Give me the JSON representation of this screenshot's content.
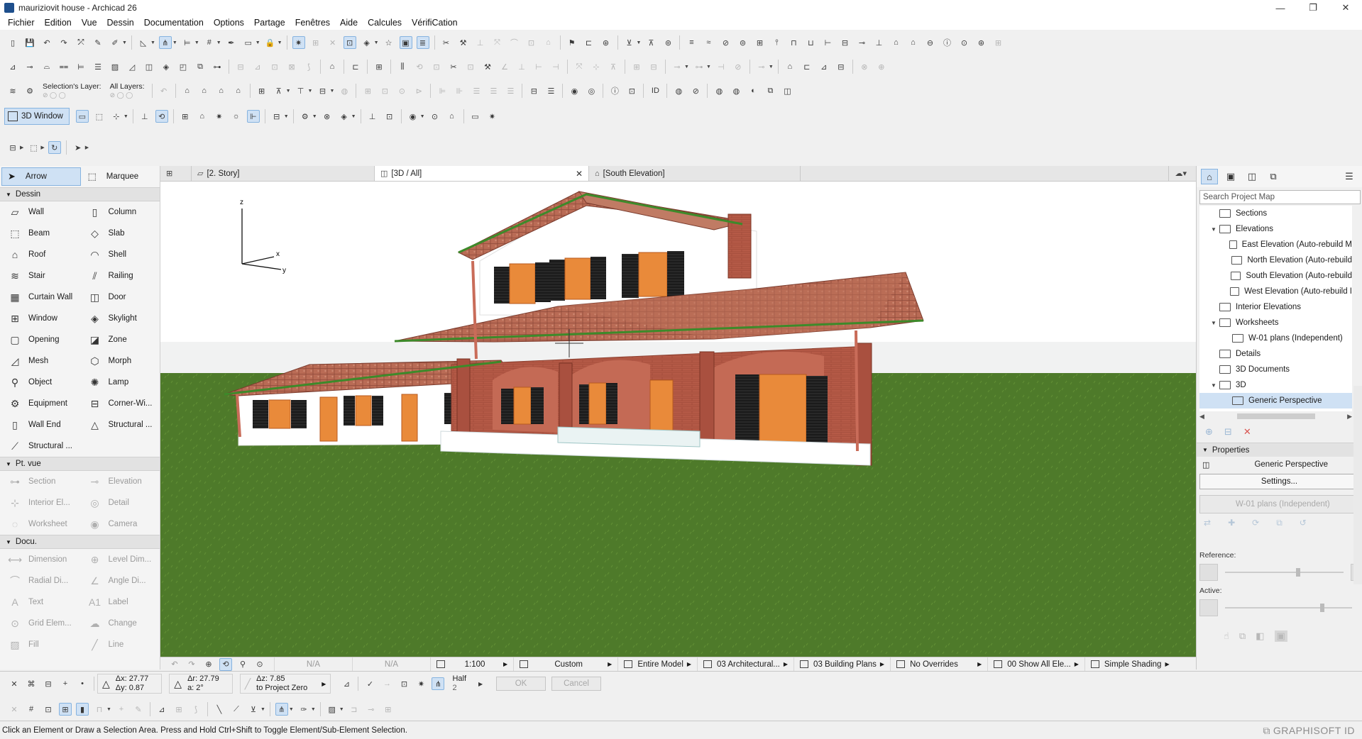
{
  "window": {
    "title": "mauriziovit house - Archicad 26",
    "minimize": "—",
    "maximize": "❐",
    "close": "✕"
  },
  "menu": [
    "Fichier",
    "Edition",
    "Vue",
    "Dessin",
    "Documentation",
    "Options",
    "Partage",
    "Fenêtres",
    "Aide",
    "Calcules",
    "VérifiCation"
  ],
  "toolbar": {
    "selection_layer_label": "Selection's Layer:",
    "all_layers_label": "All Layers:",
    "threed_window_label": "3D Window"
  },
  "toolbox": {
    "arrow_label": "Arrow",
    "marquee_label": "Marquee",
    "sections": [
      {
        "title": "Dessin",
        "tools": [
          {
            "label": "Wall",
            "icon": "wall-icon",
            "glyph": "▱"
          },
          {
            "label": "Column",
            "icon": "column-icon",
            "glyph": "▯"
          },
          {
            "label": "Beam",
            "icon": "beam-icon",
            "glyph": "⬚"
          },
          {
            "label": "Slab",
            "icon": "slab-icon",
            "glyph": "◇"
          },
          {
            "label": "Roof",
            "icon": "roof-icon",
            "glyph": "⌂"
          },
          {
            "label": "Shell",
            "icon": "shell-icon",
            "glyph": "◠"
          },
          {
            "label": "Stair",
            "icon": "stair-icon",
            "glyph": "≋"
          },
          {
            "label": "Railing",
            "icon": "railing-icon",
            "glyph": "⫽"
          },
          {
            "label": "Curtain Wall",
            "icon": "curtain-wall-icon",
            "glyph": "▦"
          },
          {
            "label": "Door",
            "icon": "door-icon",
            "glyph": "◫"
          },
          {
            "label": "Window",
            "icon": "window-icon",
            "glyph": "⊞"
          },
          {
            "label": "Skylight",
            "icon": "skylight-icon",
            "glyph": "◈"
          },
          {
            "label": "Opening",
            "icon": "opening-icon",
            "glyph": "▢"
          },
          {
            "label": "Zone",
            "icon": "zone-icon",
            "glyph": "◪"
          },
          {
            "label": "Mesh",
            "icon": "mesh-icon",
            "glyph": "◿"
          },
          {
            "label": "Morph",
            "icon": "morph-icon",
            "glyph": "⬡"
          },
          {
            "label": "Object",
            "icon": "object-icon",
            "glyph": "⚲"
          },
          {
            "label": "Lamp",
            "icon": "lamp-icon",
            "glyph": "✺"
          },
          {
            "label": "Equipment",
            "icon": "equipment-icon",
            "glyph": "⚙"
          },
          {
            "label": "Corner-Wi...",
            "icon": "corner-window-icon",
            "glyph": "⊟"
          },
          {
            "label": "Wall End",
            "icon": "wall-end-icon",
            "glyph": "▯"
          },
          {
            "label": "Structural ...",
            "icon": "structural-icon",
            "glyph": "△"
          },
          {
            "label": "Structural ...",
            "icon": "structural-icon",
            "glyph": "⟋"
          }
        ]
      },
      {
        "title": "Pt. vue",
        "tools": [
          {
            "label": "Section",
            "icon": "section-icon",
            "glyph": "⊶"
          },
          {
            "label": "Elevation",
            "icon": "elevation-icon",
            "glyph": "⊸"
          },
          {
            "label": "Interior El...",
            "icon": "interior-elevation-icon",
            "glyph": "⊹"
          },
          {
            "label": "Detail",
            "icon": "detail-icon",
            "glyph": "◎"
          },
          {
            "label": "Worksheet",
            "icon": "worksheet-icon",
            "glyph": "◌"
          },
          {
            "label": "Camera",
            "icon": "camera-icon",
            "glyph": "◉"
          }
        ]
      },
      {
        "title": "Docu.",
        "tools": [
          {
            "label": "Dimension",
            "icon": "dimension-icon",
            "glyph": "⟷"
          },
          {
            "label": "Level Dim...",
            "icon": "level-dimension-icon",
            "glyph": "⊕"
          },
          {
            "label": "Radial Di...",
            "icon": "radial-dimension-icon",
            "glyph": "⌒"
          },
          {
            "label": "Angle Di...",
            "icon": "angle-dimension-icon",
            "glyph": "∠"
          },
          {
            "label": "Text",
            "icon": "text-icon",
            "glyph": "A"
          },
          {
            "label": "Label",
            "icon": "label-icon",
            "glyph": "A1"
          },
          {
            "label": "Grid Elem...",
            "icon": "grid-element-icon",
            "glyph": "⊙"
          },
          {
            "label": "Change",
            "icon": "change-icon",
            "glyph": "☁"
          },
          {
            "label": "Fill",
            "icon": "fill-icon",
            "glyph": "▨"
          },
          {
            "label": "Line",
            "icon": "line-icon",
            "glyph": "╱"
          }
        ]
      }
    ]
  },
  "tabs": [
    {
      "label": "[2. Story]",
      "icon": "floor-plan-icon"
    },
    {
      "label": "[3D / All]",
      "icon": "threed-icon",
      "active": true
    },
    {
      "label": "[South Elevation]",
      "icon": "elevation-icon"
    }
  ],
  "viewport": {
    "axis_z": "z",
    "axis_x": "x",
    "axis_y": "y",
    "colors": {
      "sky": "#ffffff",
      "grass": "#4c7a28",
      "brick": "#b55a47",
      "roof": "#b86a52",
      "wall": "#ffffff",
      "shutter": "#1a1a1a",
      "frame": "#d97a2b"
    }
  },
  "viewbar": {
    "na1": "N/A",
    "na2": "N/A",
    "scale": "1:100",
    "pen_set": "Custom",
    "model": "Entire Model",
    "layer_combo": "03 Architectural...",
    "model_view": "03 Building Plans",
    "overrides": "No Overrides",
    "renovation": "00 Show All Ele...",
    "shading": "Simple Shading"
  },
  "project_map": {
    "search_placeholder": "Search Project Map",
    "items": [
      {
        "label": "Sections",
        "indent": 1,
        "twisty": ""
      },
      {
        "label": "Elevations",
        "indent": 1,
        "twisty": "▼"
      },
      {
        "label": "East Elevation (Auto-rebuild M",
        "indent": 2,
        "twisty": ""
      },
      {
        "label": "North Elevation (Auto-rebuild",
        "indent": 2,
        "twisty": ""
      },
      {
        "label": "South Elevation (Auto-rebuild",
        "indent": 2,
        "twisty": ""
      },
      {
        "label": "West Elevation (Auto-rebuild I",
        "indent": 2,
        "twisty": ""
      },
      {
        "label": "Interior Elevations",
        "indent": 1,
        "twisty": ""
      },
      {
        "label": "Worksheets",
        "indent": 1,
        "twisty": "▼"
      },
      {
        "label": "W-01 plans (Independent)",
        "indent": 2,
        "twisty": ""
      },
      {
        "label": "Details",
        "indent": 1,
        "twisty": ""
      },
      {
        "label": "3D Documents",
        "indent": 1,
        "twisty": ""
      },
      {
        "label": "3D",
        "indent": 1,
        "twisty": "▼"
      },
      {
        "label": "Generic Perspective",
        "indent": 2,
        "twisty": "",
        "selected": true
      }
    ]
  },
  "properties": {
    "title": "Properties",
    "view_name": "Generic Perspective",
    "settings_label": "Settings...",
    "worksheet_select": "W-01 plans (Independent)",
    "reference_label": "Reference:",
    "active_label": "Active:",
    "reference_level": 0.6,
    "active_level": 0.75
  },
  "infobox": {
    "dx": "Δx: 27.77",
    "dy": "Δy: 0.87",
    "dr": "Δr: 27.79",
    "da": "a: 2°",
    "dz": "Δz: 7.85",
    "to_project_zero": "to Project Zero",
    "half_label": "Half",
    "half_value": "2",
    "ok_label": "OK",
    "cancel_label": "Cancel"
  },
  "status": {
    "message": "Click an Element or Draw a Selection Area. Press and Hold Ctrl+Shift to Toggle Element/Sub-Element Selection.",
    "brand": "GRAPHISOFT ID"
  }
}
